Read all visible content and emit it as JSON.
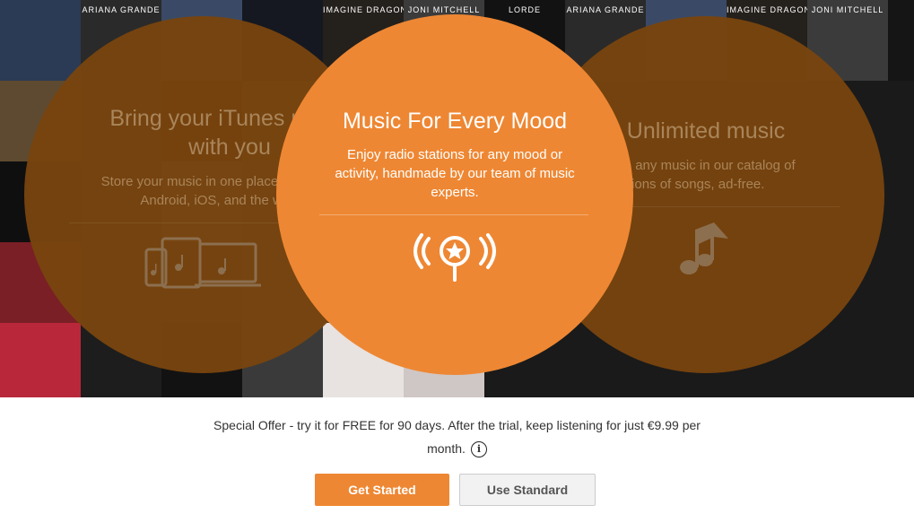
{
  "hero": {
    "album_tiles": [
      {
        "label": "",
        "color": "#2b3a55"
      },
      {
        "label": "ARIANA GRANDE",
        "color": "#2a2a2a"
      },
      {
        "label": "",
        "color": "#3a4a66"
      },
      {
        "label": "",
        "color": "#151820"
      },
      {
        "label": "IMAGINE DRAGONS",
        "color": "#24201c"
      },
      {
        "label": "JONI MITCHELL",
        "color": "#3b3b3b"
      },
      {
        "label": "",
        "color": "#5e4a30"
      },
      {
        "label": "",
        "color": "#33302a"
      },
      {
        "label": "",
        "color": "#201c18"
      },
      {
        "label": "",
        "color": "#4a4036"
      },
      {
        "label": "",
        "color": "#1c1c1c"
      },
      {
        "label": "",
        "color": "#6e6e6e"
      },
      {
        "label": "",
        "color": "#0f0f0f"
      },
      {
        "label": "",
        "color": "#2b2b2b"
      },
      {
        "label": "",
        "color": "#585858"
      },
      {
        "label": "",
        "color": "#3a3a3a"
      },
      {
        "label": "",
        "color": "#1a1a1a"
      },
      {
        "label": "",
        "color": "#9a9aa0"
      },
      {
        "label": "",
        "color": "#7a1f26"
      },
      {
        "label": "",
        "color": "#262626"
      },
      {
        "label": "",
        "color": "#2c2c2c"
      },
      {
        "label": "",
        "color": "#4a4a4a"
      },
      {
        "label": "",
        "color": "#3d3d3d"
      },
      {
        "label": "",
        "color": "#bfbcbc"
      },
      {
        "label": "",
        "color": "#b9283a"
      },
      {
        "label": "",
        "color": "#1d1d1d"
      },
      {
        "label": "",
        "color": "#121212"
      },
      {
        "label": "",
        "color": "#3a3a3a"
      },
      {
        "label": "",
        "color": "#e8e2e0"
      },
      {
        "label": "",
        "color": "#cfc7c5"
      }
    ],
    "right_tiles": [
      {
        "label": "LORDE",
        "color": "#121212"
      },
      {
        "label": "ARIANA GRANDE",
        "color": "#2a2a2a"
      },
      {
        "label": "",
        "color": "#3a4a66"
      },
      {
        "label": "IMAGINE DRAGONS",
        "color": "#24201c"
      },
      {
        "label": "JONI MITCHELL",
        "color": "#3b3b3b"
      },
      {
        "label": "",
        "color": "#151515"
      }
    ],
    "left_circle": {
      "title_line1": "Bring your iTunes music",
      "title_line2": "with you",
      "description_line1": "Store your music in one place. Listen on",
      "description_line2": "Android, iOS, and the web."
    },
    "middle_circle": {
      "title": "Music For Every Mood",
      "description_line1": "Enjoy radio stations for any mood or",
      "description_line2": "activity, handmade by our team of music",
      "description_line3": "experts."
    },
    "right_circle": {
      "title": "Unlimited music",
      "description_line1": "Listen to any music in our catalog of",
      "description_line2": "millions of songs, ad-free."
    },
    "accent_color": "#ee8733",
    "circle_dark_color": "#78440e"
  },
  "offer": {
    "text_line1": "Special Offer - try it for FREE for 90 days. After the trial, keep listening for just €9.99 per",
    "text_line2": "month.",
    "info_glyph": "i"
  },
  "buttons": {
    "get_started": "Get Started",
    "use_standard": "Use Standard"
  }
}
